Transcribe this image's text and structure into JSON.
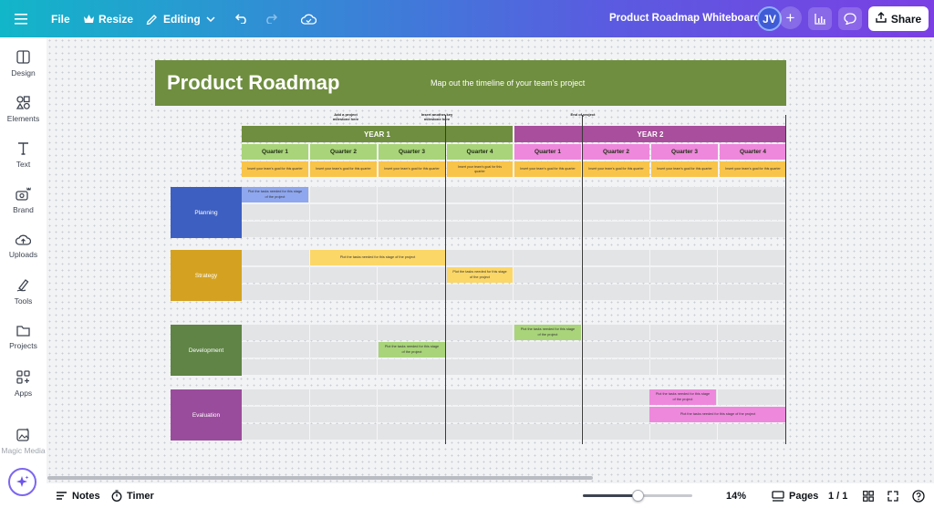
{
  "topbar": {
    "file_label": "File",
    "resize_label": "Resize",
    "editing_label": "Editing",
    "doc_title": "Product Roadmap Whiteboard",
    "avatar_initials": "JV",
    "share_label": "Share"
  },
  "sidebar": {
    "items": [
      {
        "label": "Design",
        "icon": "design-icon"
      },
      {
        "label": "Elements",
        "icon": "elements-icon"
      },
      {
        "label": "Text",
        "icon": "text-icon"
      },
      {
        "label": "Brand",
        "icon": "brand-icon"
      },
      {
        "label": "Uploads",
        "icon": "uploads-icon"
      },
      {
        "label": "Tools",
        "icon": "tools-icon"
      },
      {
        "label": "Projects",
        "icon": "projects-icon"
      },
      {
        "label": "Apps",
        "icon": "apps-icon"
      },
      {
        "label": "Magic Media",
        "icon": "magic-media-icon"
      }
    ]
  },
  "bottombar": {
    "notes_label": "Notes",
    "timer_label": "Timer",
    "zoom_level": "14%",
    "zoom_fraction": 0.5,
    "pages_label": "Pages",
    "page_count": "1 / 1"
  },
  "roadmap": {
    "title": "Product Roadmap",
    "subtitle": "Map out the timeline of your team's project",
    "milestones": [
      "Add a project milestone here",
      "Insert another key milestone here",
      "End of project"
    ],
    "years": [
      "YEAR 1",
      "YEAR 2"
    ],
    "quarters": [
      "Quarter 1",
      "Quarter 2",
      "Quarter 3",
      "Quarter 4",
      "Quarter 1",
      "Quarter 2",
      "Quarter 3",
      "Quarter 4"
    ],
    "goal_text": "Insert your team's goal for this quarter",
    "categories": [
      "Planning",
      "Strategy",
      "Development",
      "Evaluation"
    ],
    "tasks": {
      "planning_1": "Plot the tasks needed for this stage of the project",
      "strategy_1": "Plot the tasks needed for this stage of the project",
      "strategy_2": "Plot the tasks needed for this stage of the project",
      "development_1": "Plot the tasks needed for this stage of the project",
      "development_2": "Plot the tasks needed for this stage of the project",
      "evaluation_1": "Plot the tasks needed for this stage of the project",
      "evaluation_2": "Plot the tasks needed for this stage of the project"
    }
  },
  "colors": {
    "header_green": "#6f8e3f",
    "year1": "#6f8e3f",
    "year2": "#a84e9c",
    "q_green": "#a9d47a",
    "q_pink": "#ee88dc",
    "goal_yellow": "#f8c44a",
    "planning": "#3d5fc1",
    "strategy": "#d4a220",
    "development": "#5f8446",
    "evaluation": "#9a4c9c"
  }
}
